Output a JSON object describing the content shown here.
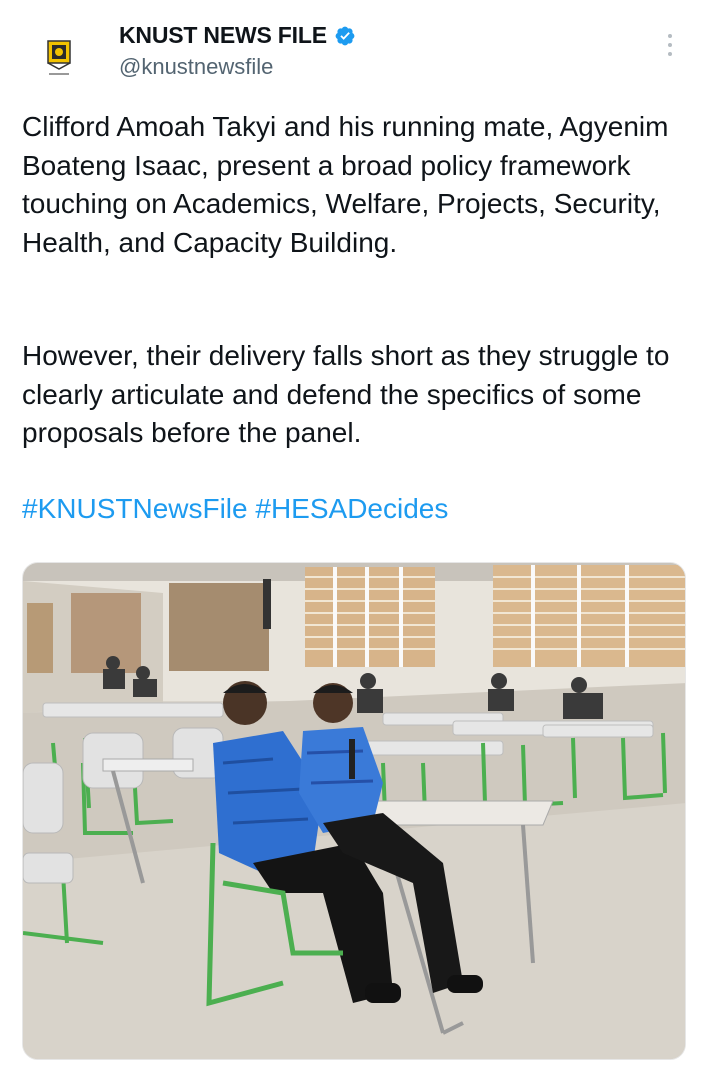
{
  "header": {
    "display_name": "KNUST NEWS FILE",
    "handle": "@knustnewsfile",
    "verified_icon": "verified-badge-icon",
    "avatar_icon": "knust-logo-icon",
    "more_icon": "vertical-dots-icon"
  },
  "post": {
    "paragraph_1": "Clifford Amoah Takyi and his running mate, Agyenim Boateng Isaac, present a broad policy framework touching on Academics, Welfare, Projects, Security, Health, and Capacity Building.",
    "paragraph_2": "However, their delivery falls short as they struggle to clearly articulate and defend the specifics of some proposals before the panel.",
    "hashtags": [
      "#KNUSTNewsFile",
      "#HESADecides"
    ]
  },
  "media": {
    "photo_icon": "lecture-hall-photo"
  },
  "colors": {
    "link": "#1d9bf0",
    "verified": "#1d9bf0",
    "text": "#0f1419",
    "secondary": "#536471"
  }
}
